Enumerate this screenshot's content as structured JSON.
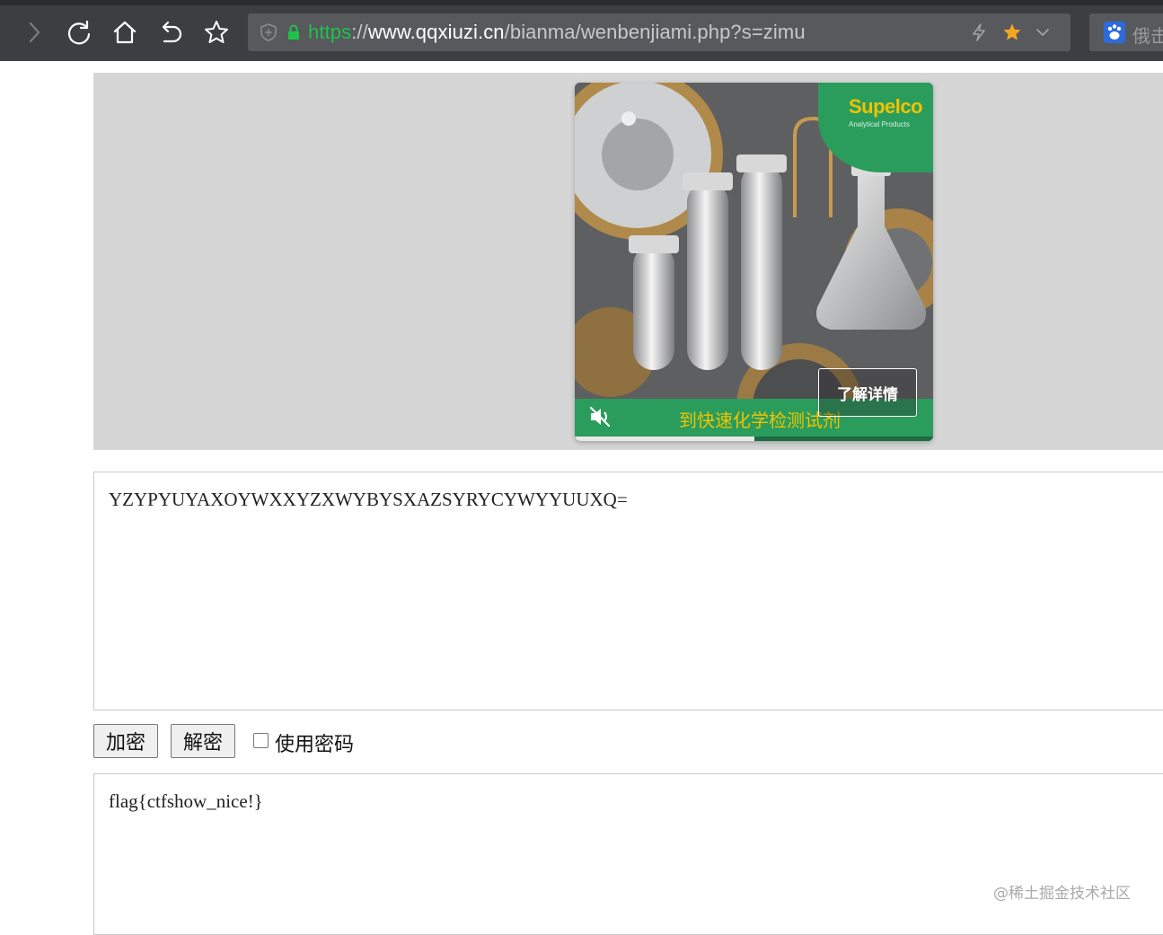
{
  "browser": {
    "url": {
      "scheme": "https",
      "separator": "://",
      "host": "www.qqxiuzi.cn",
      "path": "/bianma/wenbenjiami.php?s=zimu"
    },
    "search_engine_text": "俄击"
  },
  "ad": {
    "brand": "Supelco",
    "brand_sub": "Analytical Products",
    "cta_label": "了解详情",
    "strip_text": "到快速化学检测试剂",
    "progress": 0.5,
    "colors": {
      "brand_green": "#2a9d5c",
      "brand_yellow": "#f2c200"
    }
  },
  "tool": {
    "input_text": "YZYPYUYAXOYWXXYZXWYBYSXAZSYRYCYWYYUUXQ=",
    "encrypt_label": "加密",
    "decrypt_label": "解密",
    "use_password_label": "使用密码",
    "use_password_checked": false,
    "output_text": "flag{ctfshow_nice!}"
  },
  "watermark": "@稀土掘金技术社区",
  "icons": {
    "forward": "chevron-right-icon",
    "reload": "reload-icon",
    "home": "home-icon",
    "undo": "undo-icon",
    "bookmark": "star-icon",
    "shield": "shield-icon",
    "lock": "lock-icon",
    "lightning": "lightning-icon",
    "favorite": "star-filled-icon",
    "dropdown": "chevron-down-icon",
    "mute": "mute-icon"
  }
}
